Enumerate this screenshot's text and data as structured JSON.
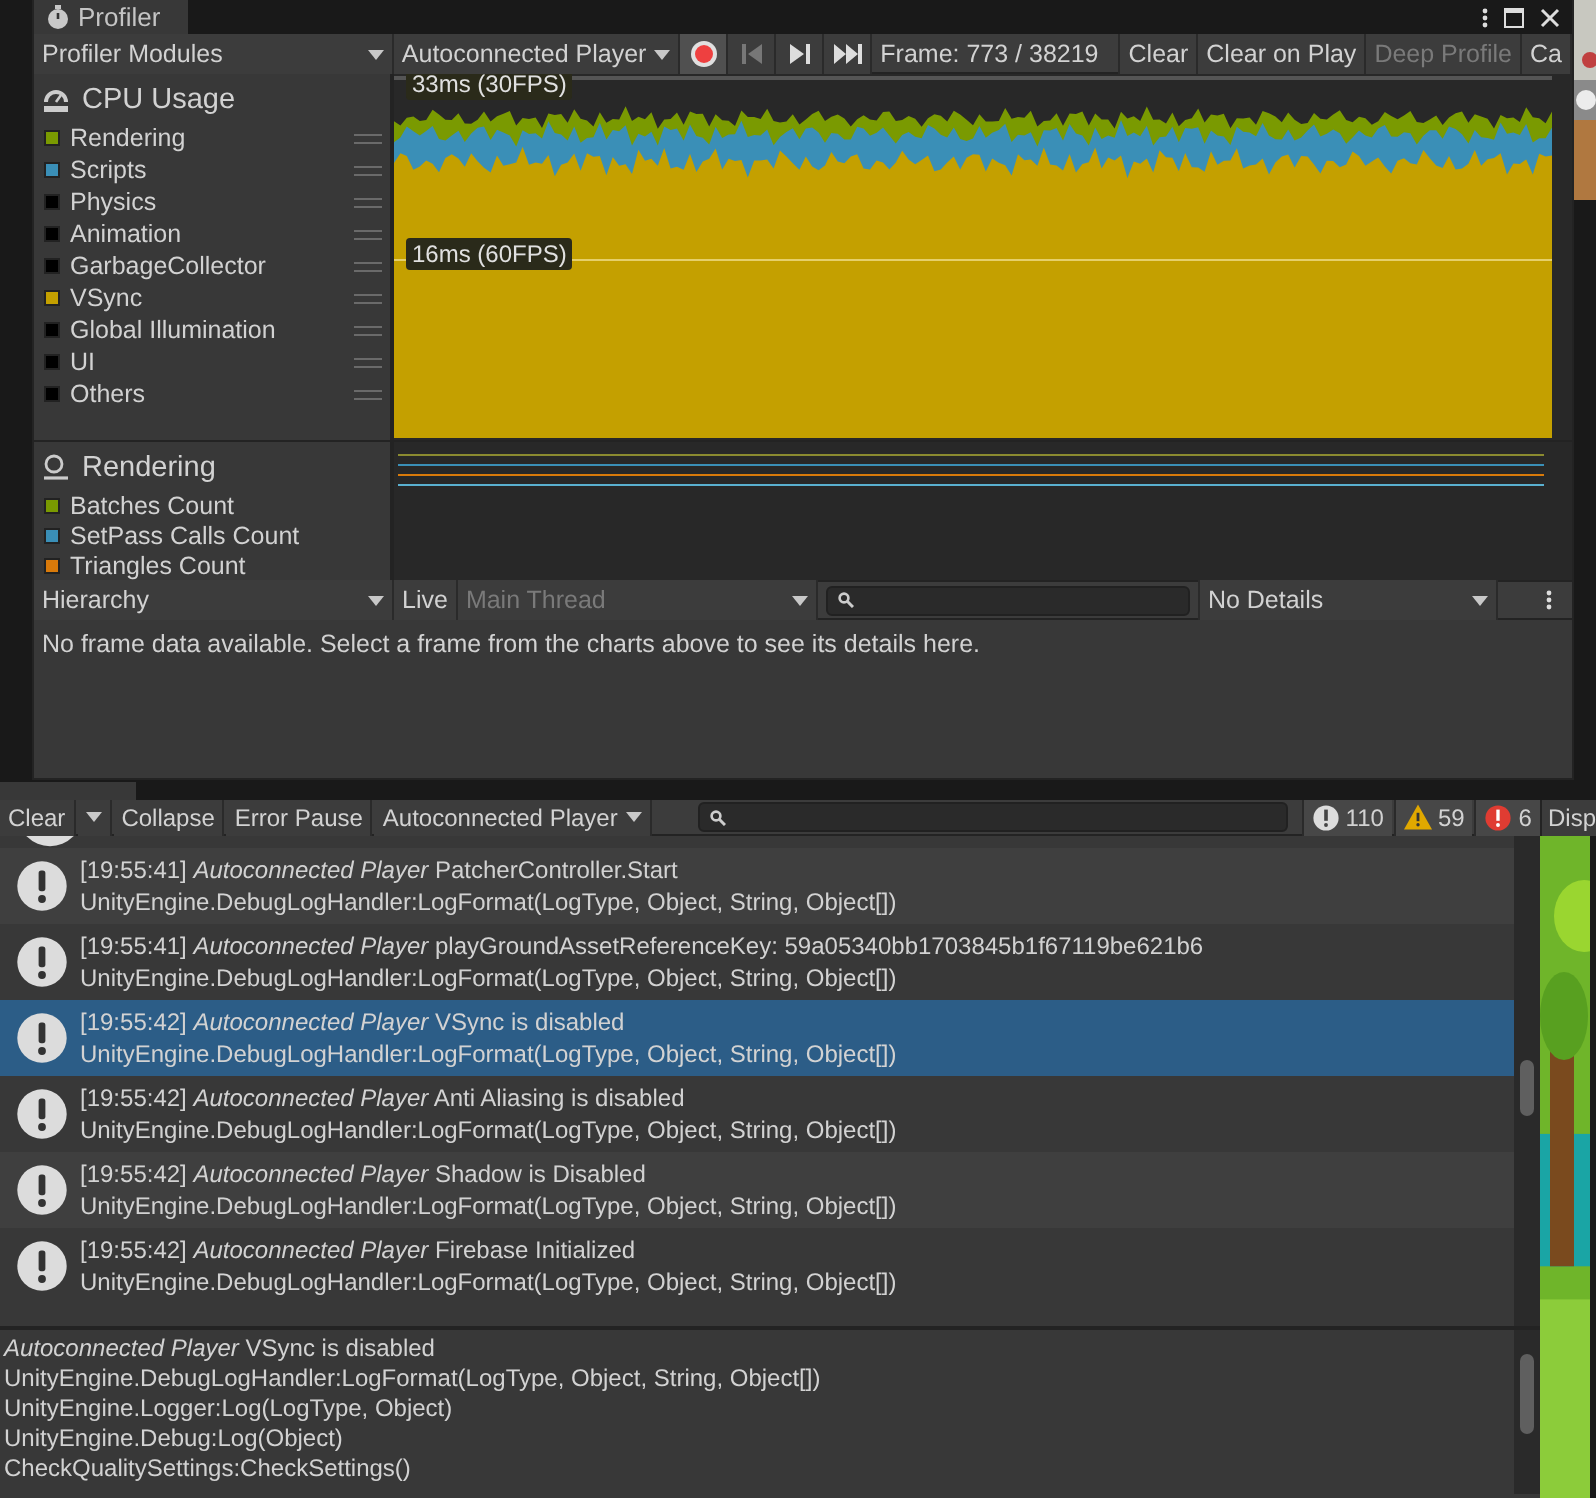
{
  "profiler": {
    "title": "Profiler",
    "modules_dropdown": "Profiler Modules",
    "player_dropdown": "Autoconnected Player",
    "frame": "Frame: 773 / 38219",
    "buttons": [
      {
        "label": "Clear",
        "disabled": false
      },
      {
        "label": "Clear on Play",
        "disabled": false
      },
      {
        "label": "Deep Profile",
        "disabled": true
      },
      {
        "label": "Ca",
        "disabled": false
      }
    ],
    "cpu_module": {
      "title": "CPU Usage",
      "items": [
        {
          "name": "Rendering",
          "color": "#7a9a01"
        },
        {
          "name": "Scripts",
          "color": "#3a8fb7"
        },
        {
          "name": "Physics",
          "color": "#000000"
        },
        {
          "name": "Animation",
          "color": "#000000"
        },
        {
          "name": "GarbageCollector",
          "color": "#000000"
        },
        {
          "name": "VSync",
          "color": "#c4a000"
        },
        {
          "name": "Global Illumination",
          "color": "#000000"
        },
        {
          "name": "UI",
          "color": "#000000"
        },
        {
          "name": "Others",
          "color": "#000000"
        }
      ]
    },
    "chart_labels": [
      "33ms (30FPS)",
      "16ms (60FPS)"
    ],
    "rendering_module": {
      "title": "Rendering",
      "items": [
        {
          "name": "Batches Count",
          "color": "#7a9a01"
        },
        {
          "name": "SetPass Calls Count",
          "color": "#3a8fb7"
        },
        {
          "name": "Triangles Count",
          "color": "#d97a0a"
        }
      ]
    },
    "details": {
      "view": "Hierarchy",
      "live": "Live",
      "thread": "Main Thread",
      "details_dropdown": "No Details",
      "message": "No frame data available. Select a frame from the charts above to see its details here."
    }
  },
  "console": {
    "toolbar": {
      "clear": "Clear",
      "collapse": "Collapse",
      "error_pause": "Error Pause",
      "player": "Autoconnected Player"
    },
    "counts": [
      {
        "kind": "info",
        "count": "110"
      },
      {
        "kind": "warning",
        "count": "59"
      },
      {
        "kind": "error",
        "count": "6"
      }
    ],
    "rows": [
      {
        "time": "[19:55:41]",
        "source": "Autoconnected Player",
        "message": "PatcherController.Start",
        "trace": "UnityEngine.DebugLogHandler:LogFormat(LogType, Object, String, Object[])",
        "selected": false
      },
      {
        "time": "[19:55:41]",
        "source": "Autoconnected Player",
        "message": "playGroundAssetReferenceKey: 59a05340bb1703845b1f67119be621b6",
        "trace": "UnityEngine.DebugLogHandler:LogFormat(LogType, Object, String, Object[])",
        "selected": false
      },
      {
        "time": "[19:55:42]",
        "source": "Autoconnected Player",
        "message": "VSync is disabled",
        "trace": "UnityEngine.DebugLogHandler:LogFormat(LogType, Object, String, Object[])",
        "selected": true
      },
      {
        "time": "[19:55:42]",
        "source": "Autoconnected Player",
        "message": "Anti Aliasing is disabled",
        "trace": "UnityEngine.DebugLogHandler:LogFormat(LogType, Object, String, Object[])",
        "selected": false
      },
      {
        "time": "[19:55:42]",
        "source": "Autoconnected Player",
        "message": "Shadow is Disabled",
        "trace": "UnityEngine.DebugLogHandler:LogFormat(LogType, Object, String, Object[])",
        "selected": false
      },
      {
        "time": "[19:55:42]",
        "source": "Autoconnected Player",
        "message": "Firebase Initialized",
        "trace": "UnityEngine.DebugLogHandler:LogFormat(LogType, Object, String, Object[])",
        "selected": false
      }
    ],
    "detail": {
      "source": "Autoconnected Player",
      "message": "VSync is disabled",
      "lines": [
        "UnityEngine.DebugLogHandler:LogFormat(LogType, Object, String, Object[])",
        "UnityEngine.Logger:Log(LogType, Object)",
        "UnityEngine.Debug:Log(Object)",
        "CheckQualitySettings:CheckSettings()"
      ]
    }
  },
  "game_view": {
    "tab": "Disp"
  }
}
